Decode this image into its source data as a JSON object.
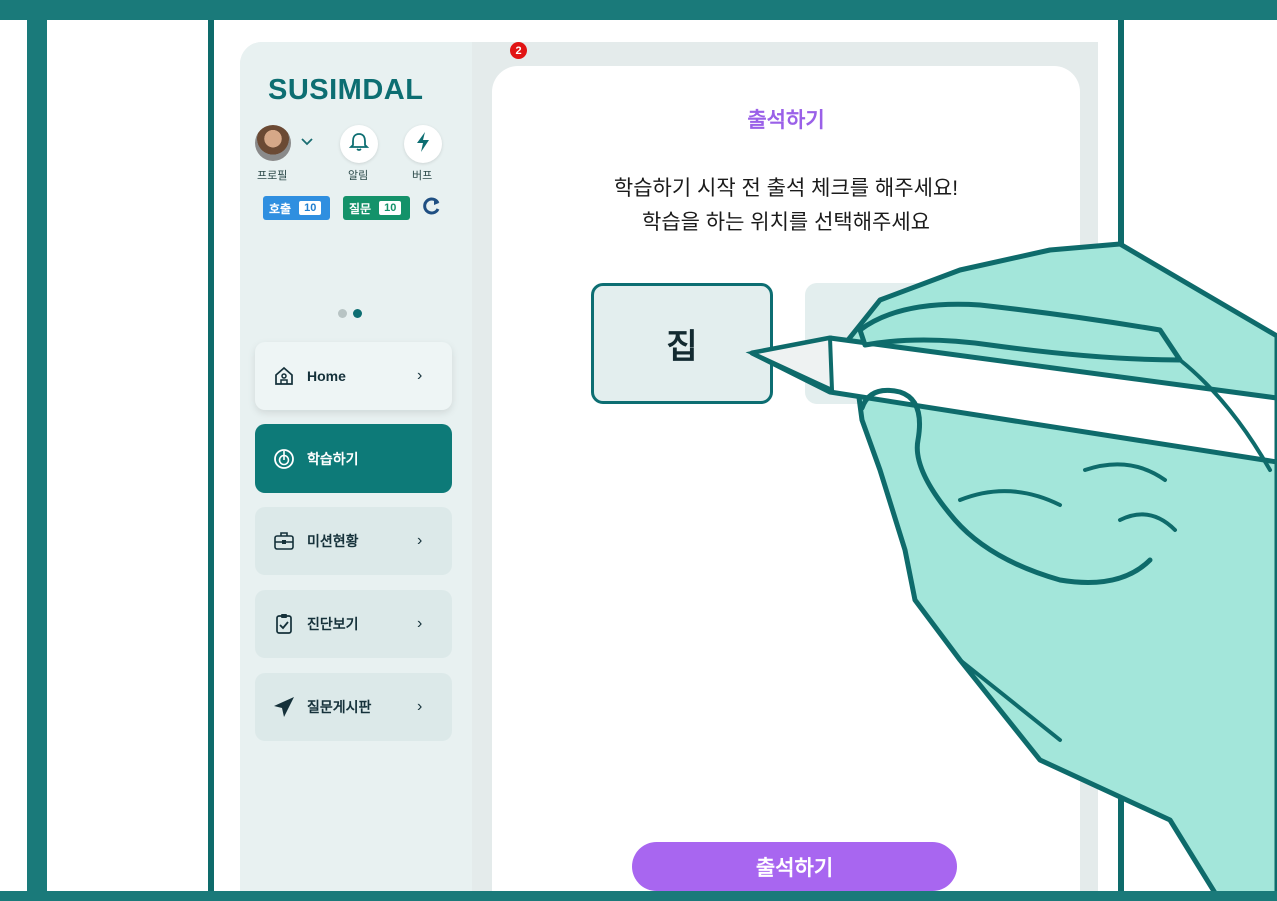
{
  "brand": {
    "logo": "SUSIMDAL"
  },
  "top_icons": {
    "profile_label": "프로필",
    "alarm_label": "알림",
    "buff_label": "버프"
  },
  "badges": {
    "call_label": "호출",
    "call_count": "10",
    "question_label": "질문",
    "question_count": "10"
  },
  "carousel": {
    "total": 2,
    "active_index": 2
  },
  "menu": [
    {
      "label": "Home",
      "icon": "home-icon",
      "active": false
    },
    {
      "label": "학습하기",
      "icon": "target-icon",
      "active": true
    },
    {
      "label": "미션현황",
      "icon": "briefcase-icon",
      "active": false
    },
    {
      "label": "진단보기",
      "icon": "clipboard-check-icon",
      "active": false
    },
    {
      "label": "질문게시판",
      "icon": "send-icon",
      "active": false
    }
  ],
  "notification": {
    "count": "2"
  },
  "attendance": {
    "title": "출석하기",
    "message_line1": "학습하기 시작 전 출석 체크를 해주세요!",
    "message_line2": "학습을 하는 위치를 선택해주세요",
    "option_home": "집",
    "submit_label": "출석하기"
  },
  "colors": {
    "frame": "#1a7a7a",
    "brand_teal": "#0d6e72",
    "accent_purple": "#a866f0",
    "call_badge": "#2f8fe0",
    "question_badge": "#14926a",
    "hand_fill": "#a3e6da"
  }
}
